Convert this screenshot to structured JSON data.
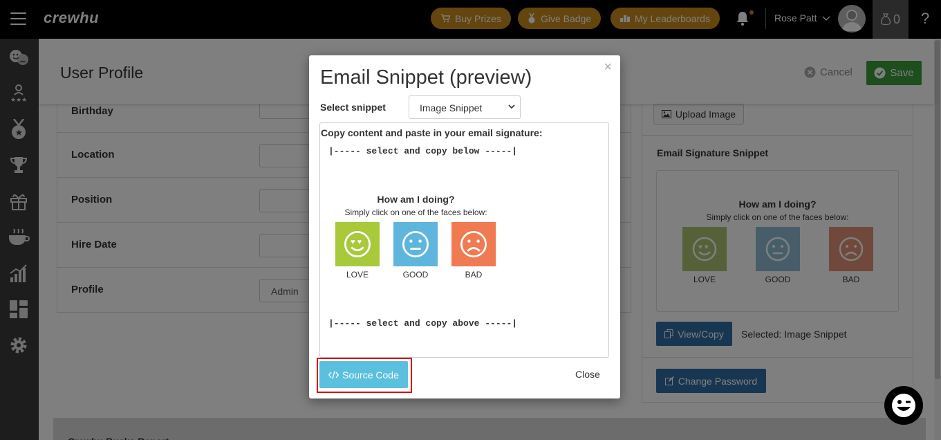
{
  "topbar": {
    "logo": "crewhu",
    "buy_prizes": "Buy Prizes",
    "give_badge": "Give Badge",
    "my_leaderboards": "My Leaderboards",
    "user_name": "Rose Patt",
    "bucks_count": "0",
    "help": "?"
  },
  "sidebar": {
    "icons": [
      "emotions-icon",
      "team-stars-icon",
      "badge-medal-icon",
      "trophy-icon",
      "gift-icon",
      "coffee-icon",
      "analytics-icon",
      "dashboard-icon",
      "gear-icon"
    ]
  },
  "page": {
    "title": "User Profile",
    "cancel_label": "Cancel",
    "save_label": "Save",
    "form": {
      "birthday_label": "Birthday",
      "location_label": "Location",
      "position_label": "Position",
      "hire_date_label": "Hire Date",
      "profile_label": "Profile",
      "profile_value": "Admin"
    },
    "right": {
      "upload_label": "Upload Image",
      "sig_title": "Email Signature Snippet",
      "view_copy_label": "View/Copy",
      "selected_text": "Selected: Image Snippet",
      "change_password_label": "Change Password"
    },
    "bucks_report": "Crewhu Bucks Report"
  },
  "faces": {
    "title": "How am I doing?",
    "subtitle": "Simply click on one of the faces below:",
    "items": [
      {
        "label": "LOVE",
        "color": "#a7c93a"
      },
      {
        "label": "GOOD",
        "color": "#5fb6dd"
      },
      {
        "label": "BAD",
        "color": "#f07a52"
      }
    ]
  },
  "modal": {
    "title": "Email Snippet (preview)",
    "select_label": "Select snippet",
    "select_value": "Image Snippet",
    "instructions": "Copy content and paste in your email signature:",
    "marker_top": "|----- select and copy below -----|",
    "marker_bottom": "|----- select and copy above -----|",
    "source_code_label": "Source Code",
    "close_label": "Close",
    "close_x": "×"
  },
  "colors": {
    "topbar": "#000000",
    "pill": "#c98a1c",
    "save": "#3c9a3c",
    "primary": "#2e6da4",
    "info": "#5bc0de",
    "highlight": "#dd0000"
  }
}
